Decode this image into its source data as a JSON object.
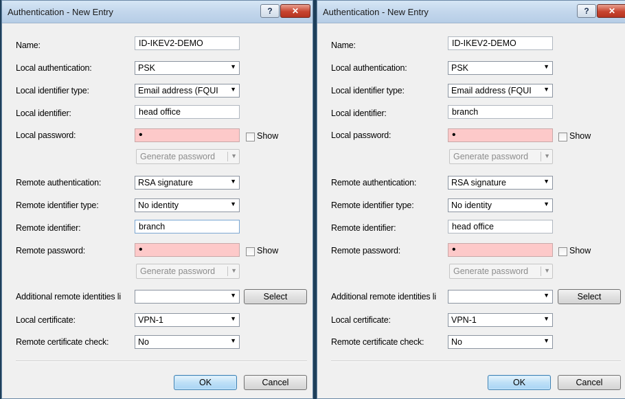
{
  "dialogs": [
    {
      "title": "Authentication - New Entry",
      "help_label": "?",
      "close_label": "✕",
      "labels": {
        "name": "Name:",
        "local_auth": "Local authentication:",
        "local_id_type": "Local identifier type:",
        "local_id": "Local identifier:",
        "local_pwd": "Local password:",
        "remote_auth": "Remote authentication:",
        "remote_id_type": "Remote identifier type:",
        "remote_id": "Remote identifier:",
        "remote_pwd": "Remote password:",
        "additional_ids": "Additional remote identities li",
        "local_cert": "Local certificate:",
        "remote_cert_check": "Remote certificate check:"
      },
      "values": {
        "name": "ID-IKEV2-DEMO",
        "local_auth": "PSK",
        "local_id_type": "Email address (FQUI",
        "local_id": "head office",
        "local_pwd": "•",
        "remote_auth": "RSA signature",
        "remote_id_type": "No identity",
        "remote_id": "branch",
        "remote_pwd": "•",
        "additional_ids": "",
        "local_cert": "VPN-1",
        "remote_cert_check": "No"
      },
      "show_label": "Show",
      "generate_label": "Generate password",
      "select_label": "Select",
      "ok_label": "OK",
      "cancel_label": "Cancel"
    },
    {
      "title": "Authentication - New Entry",
      "help_label": "?",
      "close_label": "✕",
      "labels": {
        "name": "Name:",
        "local_auth": "Local authentication:",
        "local_id_type": "Local identifier type:",
        "local_id": "Local identifier:",
        "local_pwd": "Local password:",
        "remote_auth": "Remote authentication:",
        "remote_id_type": "Remote identifier type:",
        "remote_id": "Remote identifier:",
        "remote_pwd": "Remote password:",
        "additional_ids": "Additional remote identities li",
        "local_cert": "Local certificate:",
        "remote_cert_check": "Remote certificate check:"
      },
      "values": {
        "name": "ID-IKEV2-DEMO",
        "local_auth": "PSK",
        "local_id_type": "Email address (FQUI",
        "local_id": "branch",
        "local_pwd": "•",
        "remote_auth": "RSA signature",
        "remote_id_type": "No identity",
        "remote_id": "head office",
        "remote_pwd": "•",
        "additional_ids": "",
        "local_cert": "VPN-1",
        "remote_cert_check": "No"
      },
      "show_label": "Show",
      "generate_label": "Generate password",
      "select_label": "Select",
      "ok_label": "OK",
      "cancel_label": "Cancel"
    }
  ]
}
